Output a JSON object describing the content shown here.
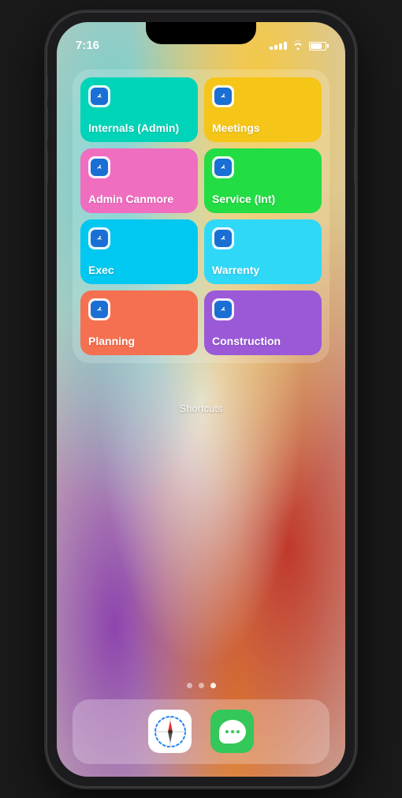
{
  "status_bar": {
    "time": "7:16"
  },
  "widgets": [
    {
      "id": "internals-admin",
      "label": "Internals (Admin)",
      "color": "#00d4b8",
      "text_color": "#fff"
    },
    {
      "id": "meetings",
      "label": "Meetings",
      "color": "#f5c518",
      "text_color": "#fff"
    },
    {
      "id": "admin-canmore",
      "label": "Admin Canmore",
      "color": "#f06ec0",
      "text_color": "#fff"
    },
    {
      "id": "service-int",
      "label": "Service (Int)",
      "color": "#22dd44",
      "text_color": "#fff"
    },
    {
      "id": "exec",
      "label": "Exec",
      "color": "#00c8f0",
      "text_color": "#fff"
    },
    {
      "id": "warrenty",
      "label": "Warrenty",
      "color": "#30d8f8",
      "text_color": "#fff"
    },
    {
      "id": "planning",
      "label": "Planning",
      "color": "#f57050",
      "text_color": "#fff"
    },
    {
      "id": "construction",
      "label": "Construction",
      "color": "#9b59d8",
      "text_color": "#fff"
    }
  ],
  "shortcuts_label": "Shortcuts",
  "page_dots": [
    {
      "active": false
    },
    {
      "active": false
    },
    {
      "active": true
    }
  ],
  "dock": {
    "apps": [
      {
        "id": "safari",
        "label": "Safari"
      },
      {
        "id": "messages",
        "label": "Messages"
      }
    ]
  }
}
